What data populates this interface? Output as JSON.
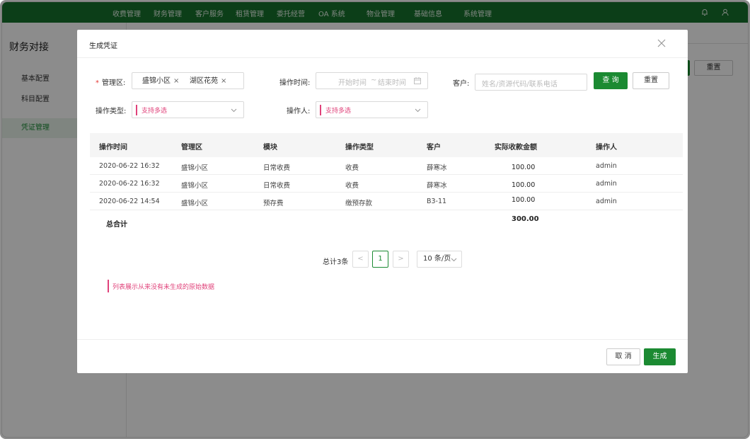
{
  "topnav": {
    "items": [
      "收费管理",
      "财务管理",
      "客户服务",
      "租赁管理",
      "委托经营",
      "OA 系统",
      "物业管理",
      "基础信息",
      "系统管理"
    ],
    "icons": [
      "bell-icon",
      "user-icon"
    ],
    "color": "#17722c"
  },
  "sidebar": {
    "title": "财务对接",
    "items": [
      {
        "label": "基本配置"
      },
      {
        "label": "科目配置"
      },
      {
        "label": "凭证管理"
      }
    ]
  },
  "background": {
    "reset_label": "重置"
  },
  "modal": {
    "title": "生成凭证",
    "filters": {
      "area_label": "管理区:",
      "area_tags": [
        "盛锦小区",
        "湖区花苑"
      ],
      "time_label": "操作时间:",
      "time_start_placeholder": "开始时间",
      "time_sep": "~",
      "time_end_placeholder": "结束时间",
      "customer_label": "客户:",
      "customer_placeholder": "姓名/资源代码/联系电话",
      "query_label": "查 询",
      "reset_label": "重置",
      "op_type_label": "操作类型:",
      "op_type_placeholder": "支持多选",
      "operator_label": "操作人:",
      "operator_placeholder": "支持多选"
    },
    "table": {
      "columns": [
        "操作时间",
        "管理区",
        "模块",
        "操作类型",
        "客户",
        "实际收款金额",
        "操作人"
      ],
      "rows": [
        [
          "2020-06-22 16:32",
          "盛锦小区",
          "日常收费",
          "收费",
          "薛寒冰",
          "100.00",
          "admin"
        ],
        [
          "2020-06-22 16:32",
          "盛锦小区",
          "日常收费",
          "收费",
          "薛寒冰",
          "100.00",
          "admin"
        ],
        [
          "2020-06-22 14:54",
          "盛锦小区",
          "预存费",
          "缴预存款",
          "B3-11",
          "100.00",
          "admin"
        ]
      ],
      "total_label": "总合计",
      "total_value": "300.00"
    },
    "pagination": {
      "total_text": "总计3条",
      "prev": "<",
      "current_page": "1",
      "next": ">",
      "page_size": "10 条/页"
    },
    "note": "列表展示从来没有未生成的原始数据",
    "footer": {
      "cancel_label": "取 消",
      "generate_label": "生成"
    },
    "accent_color": "#1b8a32",
    "hint_color": "#e0427a"
  }
}
